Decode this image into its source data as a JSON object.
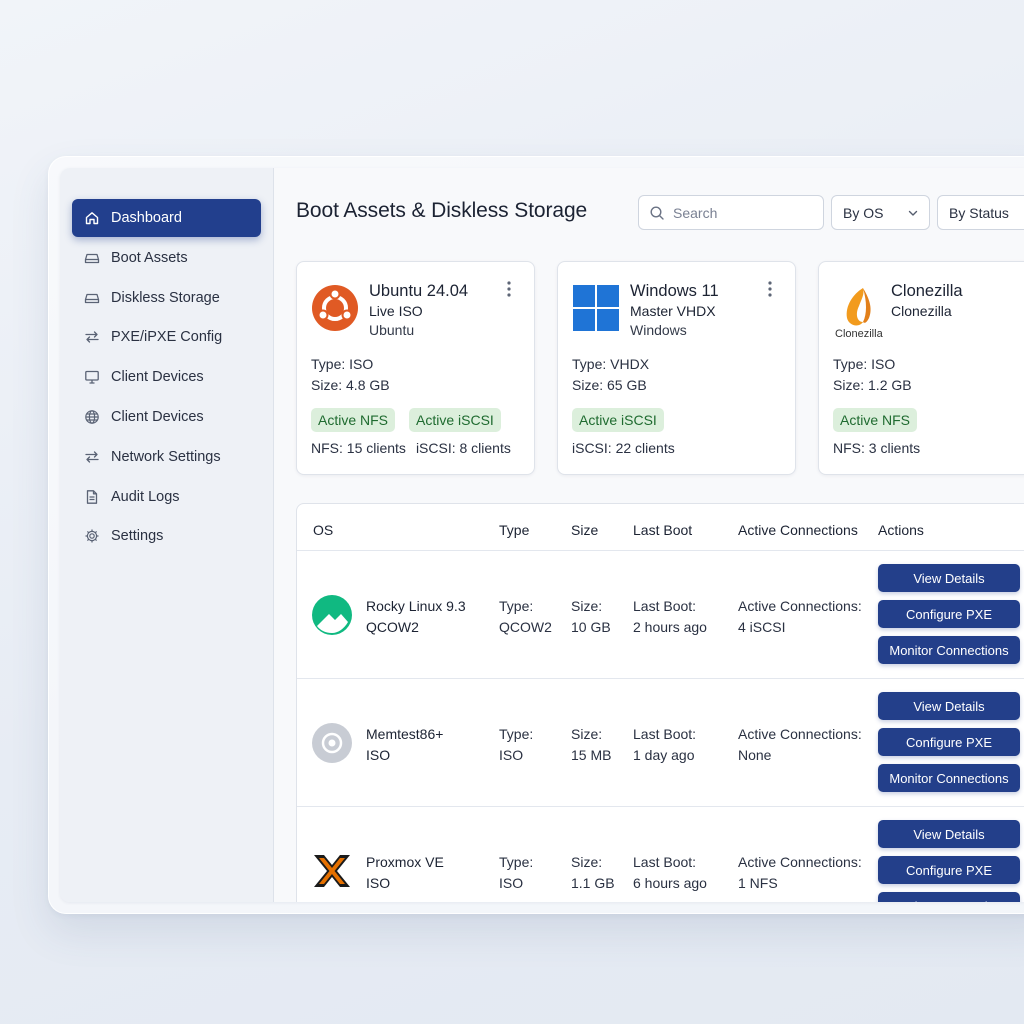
{
  "sidebar": {
    "items": [
      {
        "label": "Dashboard",
        "icon": "home-icon",
        "active": true
      },
      {
        "label": "Boot Assets",
        "icon": "drive-icon"
      },
      {
        "label": "Diskless Storage",
        "icon": "drive-icon"
      },
      {
        "label": "PXE/iPXE Config",
        "icon": "swap-arrows-icon"
      },
      {
        "label": "Client Devices",
        "icon": "monitor-icon"
      },
      {
        "label": "Client Devices",
        "icon": "globe-icon"
      },
      {
        "label": "Network Settings",
        "icon": "swap-arrows-icon"
      },
      {
        "label": "Audit Logs",
        "icon": "document-icon"
      },
      {
        "label": "Settings",
        "icon": "gear-icon"
      }
    ]
  },
  "header": {
    "title": "Boot Assets & Diskless Storage",
    "search_placeholder": "Search",
    "filter_os": "By OS",
    "filter_status": "By Status"
  },
  "cards": [
    {
      "name": "Ubuntu 24.04",
      "subtitle": "Live ISO",
      "os": "Ubuntu",
      "type": "Type: ISO",
      "size": "Size: 4.8 GB",
      "badges": [
        "Active NFS",
        "Active iSCSI"
      ],
      "clients": [
        "NFS: 15 clients",
        "iSCSI: 8 clients"
      ],
      "logo_color": "#e05a24"
    },
    {
      "name": "Windows 11",
      "subtitle": "Master VHDX",
      "os": "Windows",
      "type": "Type: VHDX",
      "size": "Size: 65 GB",
      "badges": [
        "Active iSCSI"
      ],
      "clients": [
        "iSCSI: 22 clients"
      ],
      "logo_color": "#1f74d6"
    },
    {
      "name": "Clonezilla",
      "subtitle": "Clonezilla",
      "logo_caption": "Clonezilla",
      "type": "Type: ISO",
      "size": "Size: 1.2 GB",
      "badges": [
        "Active NFS"
      ],
      "clients": [
        "NFS: 3 clients"
      ],
      "logo_color": "#f29b1d"
    }
  ],
  "table": {
    "headers": {
      "os": "OS",
      "type": "Type",
      "size": "Size",
      "last_boot": "Last Boot",
      "active": "Active Connections",
      "actions": "Actions"
    },
    "rows": [
      {
        "name": "Rocky Linux 9.3",
        "format": "QCOW2",
        "type_label": "Type:",
        "type": "QCOW2",
        "size_label": "Size:",
        "size": "10 GB",
        "last_label": "Last Boot:",
        "last": "2 hours ago",
        "active_label": "Active Connections:",
        "active": "4 iSCSI",
        "logo_color": "#10b981"
      },
      {
        "name": "Memtest86+",
        "format": "ISO",
        "type_label": "Type:",
        "type": "ISO",
        "size_label": "Size:",
        "size": "15 MB",
        "last_label": "Last Boot:",
        "last": "1 day ago",
        "active_label": "Active Connections:",
        "active": "None",
        "logo_color": "#c8ccd4"
      },
      {
        "name": "Proxmox VE",
        "format": "ISO",
        "type_label": "Type:",
        "type": "ISO",
        "size_label": "Size:",
        "size": "1.1 GB",
        "last_label": "Last Boot:",
        "last": "6 hours ago",
        "active_label": "Active Connections:",
        "active": "1 NFS",
        "logo_color": "#e57000"
      }
    ],
    "buttons": {
      "view": "View Details",
      "configure": "Configure PXE",
      "monitor": "Monitor Connections"
    }
  },
  "colors": {
    "accent": "#223f8d",
    "badge_bg": "#dcefdc",
    "badge_text": "#1f6b30"
  }
}
